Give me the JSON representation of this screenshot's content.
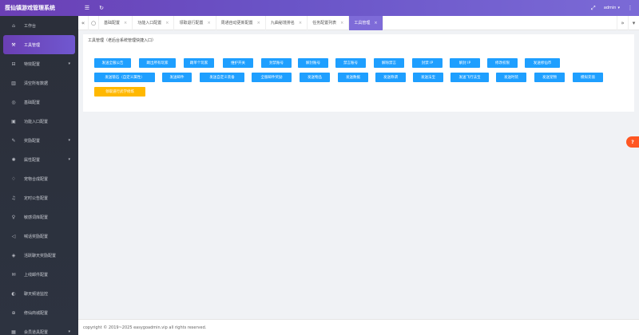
{
  "header": {
    "title": "揽仙镇游戏管理系统",
    "menu_icon": "hamburger-icon",
    "refresh_icon": "refresh-icon",
    "fullscreen_icon": "fullscreen-icon",
    "user": "admin",
    "user_caret": "▾",
    "more_icon": "more-icon"
  },
  "sidebar": {
    "items": [
      {
        "label": "工作台",
        "icon": "home-icon",
        "glyph": "⌂"
      },
      {
        "label": "工具管理",
        "icon": "tool-icon",
        "glyph": "⚒"
      },
      {
        "label": "特效配置",
        "icon": "effect-icon",
        "glyph": "⊟"
      },
      {
        "label": "清空所有数据",
        "icon": "trash-icon",
        "glyph": "▥"
      },
      {
        "label": "基础配置",
        "icon": "settings-icon",
        "glyph": "◎"
      },
      {
        "label": "功能入口配置",
        "icon": "entry-icon",
        "glyph": "▣"
      },
      {
        "label": "奖励配置",
        "icon": "reward-icon",
        "glyph": "✎"
      },
      {
        "label": "属性配置",
        "icon": "attribute-icon",
        "glyph": "✺"
      },
      {
        "label": "宠物合成配置",
        "icon": "diamond-icon",
        "glyph": "♢"
      },
      {
        "label": "定时公告配置",
        "icon": "bell-icon",
        "glyph": "♫"
      },
      {
        "label": "敏感词库配置",
        "icon": "bulb-icon",
        "glyph": "♀"
      },
      {
        "label": "喊话奖励配置",
        "icon": "speaker-icon",
        "glyph": "◁"
      },
      {
        "label": "活跃聊天奖励配置",
        "icon": "chat-icon",
        "glyph": "◈"
      },
      {
        "label": "上线邮件配置",
        "icon": "mail-icon",
        "glyph": "✉"
      },
      {
        "label": "聊天频道监控",
        "icon": "monitor-icon",
        "glyph": "◐"
      },
      {
        "label": "修仙商城配置",
        "icon": "shop-icon",
        "glyph": "⊕"
      },
      {
        "label": "会员道具配置",
        "icon": "vip-icon",
        "glyph": "▦"
      }
    ],
    "active_index": 1
  },
  "tabs": {
    "left_nav": "«",
    "home_icon": "○",
    "items": [
      {
        "label": "基础配置",
        "close": "×"
      },
      {
        "label": "功能入口配置",
        "close": "×"
      },
      {
        "label": "领取退行配置",
        "close": "×"
      },
      {
        "label": "周通自动更新配置",
        "close": "×"
      },
      {
        "label": "九曲秘境排名",
        "close": "×"
      },
      {
        "label": "任务配置列表",
        "close": "×"
      },
      {
        "label": "工具管理",
        "close": "×"
      }
    ],
    "active_index": 6,
    "right_nav": "»",
    "dropdown": "▾"
  },
  "card": {
    "title": "工具管理（老后台系统管理快捷入口）",
    "rows": [
      [
        {
          "label": "发送全服公告",
          "type": "primary"
        },
        {
          "label": "踢出所有玩家",
          "type": "primary"
        },
        {
          "label": "踢单个玩家",
          "type": "primary"
        },
        {
          "label": "维护开关",
          "type": "primary"
        },
        {
          "label": "封禁账号",
          "type": "primary"
        },
        {
          "label": "解封账号",
          "type": "primary"
        },
        {
          "label": "禁言账号",
          "type": "primary"
        },
        {
          "label": "解除禁言",
          "type": "primary"
        },
        {
          "label": "封禁 IP",
          "type": "primary"
        },
        {
          "label": "解封 IP",
          "type": "primary"
        },
        {
          "label": "修改权限",
          "type": "primary"
        },
        {
          "label": "发送修仙币",
          "type": "primary"
        }
      ],
      [
        {
          "label": "发送镜石（自定义属性）",
          "type": "primary"
        },
        {
          "label": "发送邮件",
          "type": "primary"
        },
        {
          "label": "发送自定义装备",
          "type": "primary"
        },
        {
          "label": "全服邮件奖励",
          "type": "primary"
        },
        {
          "label": "发送物品",
          "type": "primary"
        },
        {
          "label": "发送数据",
          "type": "primary"
        },
        {
          "label": "发送称谓",
          "type": "primary"
        },
        {
          "label": "发送法宝",
          "type": "primary"
        },
        {
          "label": "发送飞行法宝",
          "type": "primary"
        },
        {
          "label": "发送时装",
          "type": "primary"
        },
        {
          "label": "发送宠物",
          "type": "primary"
        },
        {
          "label": "模拟充值",
          "type": "primary"
        }
      ],
      [
        {
          "label": "领取道行武学修炼",
          "type": "warn"
        }
      ]
    ]
  },
  "footer": {
    "text": "copyright © 2019~2025 easygoadmin.vip all rights reserved."
  },
  "float_widget": {
    "icon": "feedback-icon",
    "glyph": "?"
  },
  "colors": {
    "primary_button": "#1e9fff",
    "warn_button": "#ffb800",
    "header_gradient_start": "#6b3fb5",
    "active_tab": "#7e6bd8",
    "sidebar_bg": "#2b2f3a"
  }
}
